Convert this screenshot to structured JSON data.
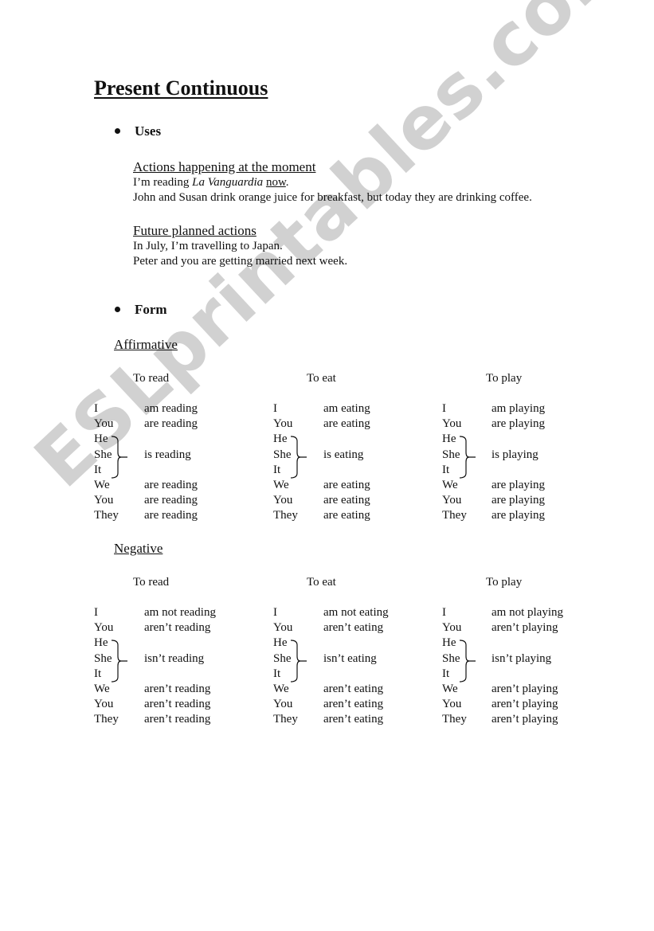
{
  "title": "Present Continuous",
  "uses": {
    "bullet": "Uses",
    "groups": [
      {
        "heading": "Actions happening at the moment",
        "example1": {
          "pre": "I’m reading ",
          "italic": "La Vanguardia",
          "mid": " ",
          "underlined": "now",
          "post": "."
        },
        "example2": "John and Susan drink orange juice for breakfast, but today they are drinking coffee."
      },
      {
        "heading": "Future planned actions",
        "example1": "In July, I’m travelling to Japan.",
        "example2": "Peter and you are getting married next week."
      }
    ]
  },
  "form": {
    "bullet": "Form",
    "sections": [
      {
        "heading": "Affirmative",
        "verbs": [
          {
            "label": "To read",
            "rows": [
              "am reading",
              "are reading",
              "is reading",
              "are reading",
              "are reading",
              "are reading"
            ]
          },
          {
            "label": "To eat",
            "rows": [
              "am eating",
              "are eating",
              "is eating",
              "are eating",
              "are eating",
              "are eating"
            ]
          },
          {
            "label": "To play",
            "rows": [
              "am playing",
              "are playing",
              "is playing",
              "are playing",
              "are playing",
              "are playing"
            ]
          }
        ]
      },
      {
        "heading": "Negative",
        "verbs": [
          {
            "label": "To read",
            "rows": [
              "am  not reading",
              "aren’t reading",
              "isn’t reading",
              "aren’t reading",
              "aren’t reading",
              "aren’t reading"
            ]
          },
          {
            "label": "To eat",
            "rows": [
              "am not eating",
              "aren’t eating",
              "isn’t eating",
              "aren’t eating",
              "aren’t eating",
              "aren’t eating"
            ]
          },
          {
            "label": "To play",
            "rows": [
              "am not playing",
              "aren’t playing",
              "isn’t playing",
              "aren’t playing",
              "aren’t playing",
              "aren’t playing"
            ]
          }
        ]
      }
    ],
    "pronouns": [
      "I",
      "You",
      "He",
      "She",
      "It",
      "We",
      "You",
      "They"
    ]
  },
  "watermark": "ESLprintables.com"
}
